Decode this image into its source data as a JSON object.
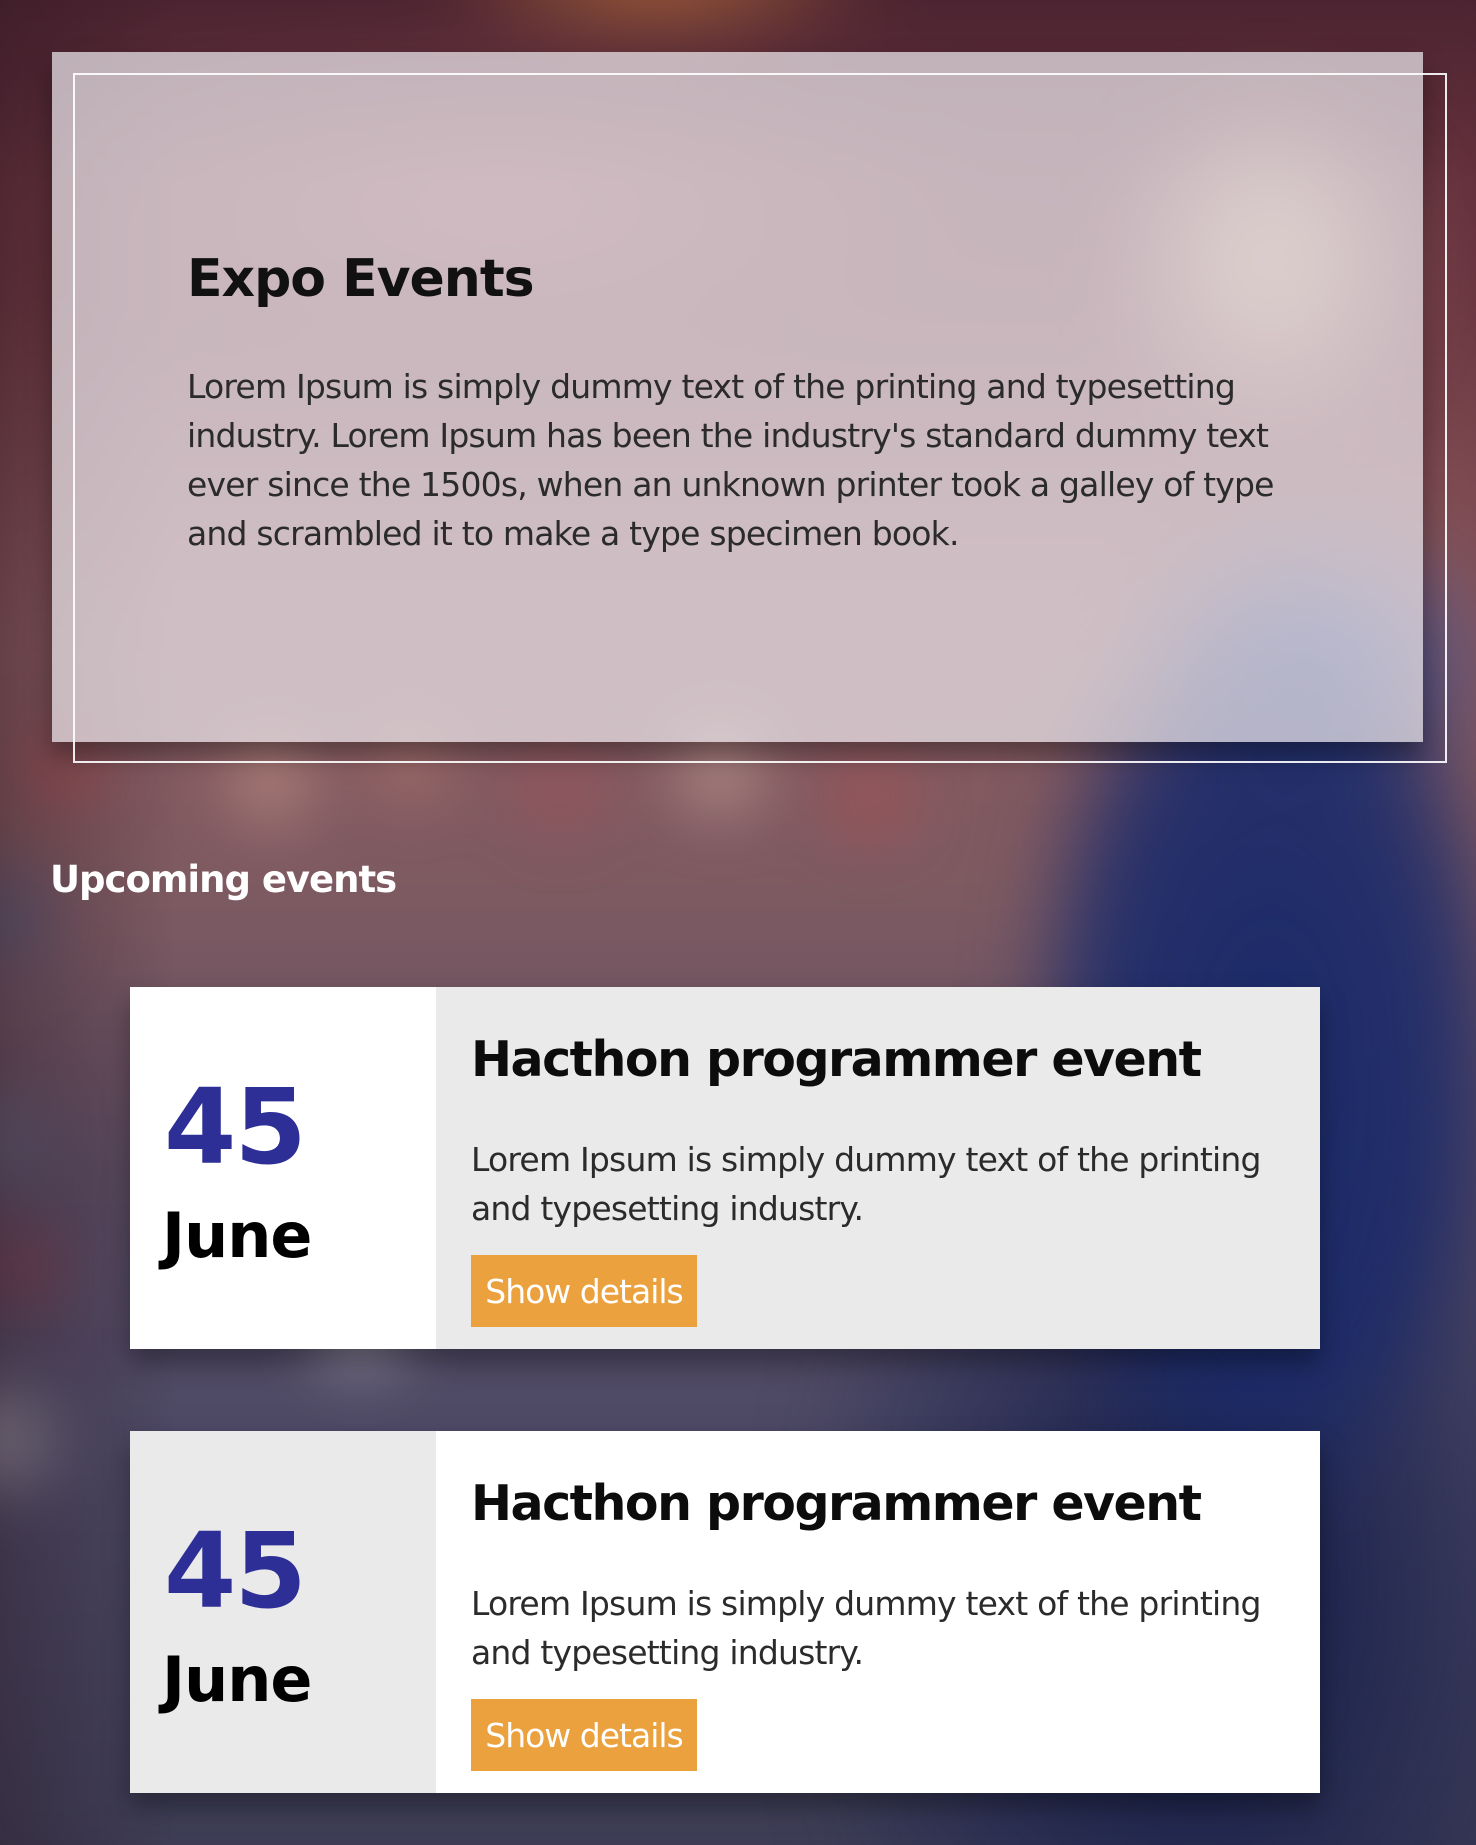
{
  "hero": {
    "title": "Expo Events",
    "text": "Lorem Ipsum is simply dummy text of the printing and typesetting industry. Lorem Ipsum has been the industry's standard dummy text ever since the 1500s, when an unknown printer took a galley of type and scrambled it to make a type specimen book."
  },
  "upcoming": {
    "heading": "Upcoming events"
  },
  "events": [
    {
      "day": "45",
      "month": "June",
      "title": "Hacthon programmer event",
      "description": "Lorem Ipsum is simply dummy text of the printing and typesetting industry.",
      "button_label": "Show details"
    },
    {
      "day": "45",
      "month": "June",
      "title": "Hacthon programmer event",
      "description": "Lorem Ipsum is simply dummy text of the printing and typesetting industry.",
      "button_label": "Show details"
    }
  ],
  "colors": {
    "accent_button": "#eba13d",
    "date_number": "#2d2f96",
    "card_gray": "#eaeaea",
    "card_white": "#ffffff"
  }
}
